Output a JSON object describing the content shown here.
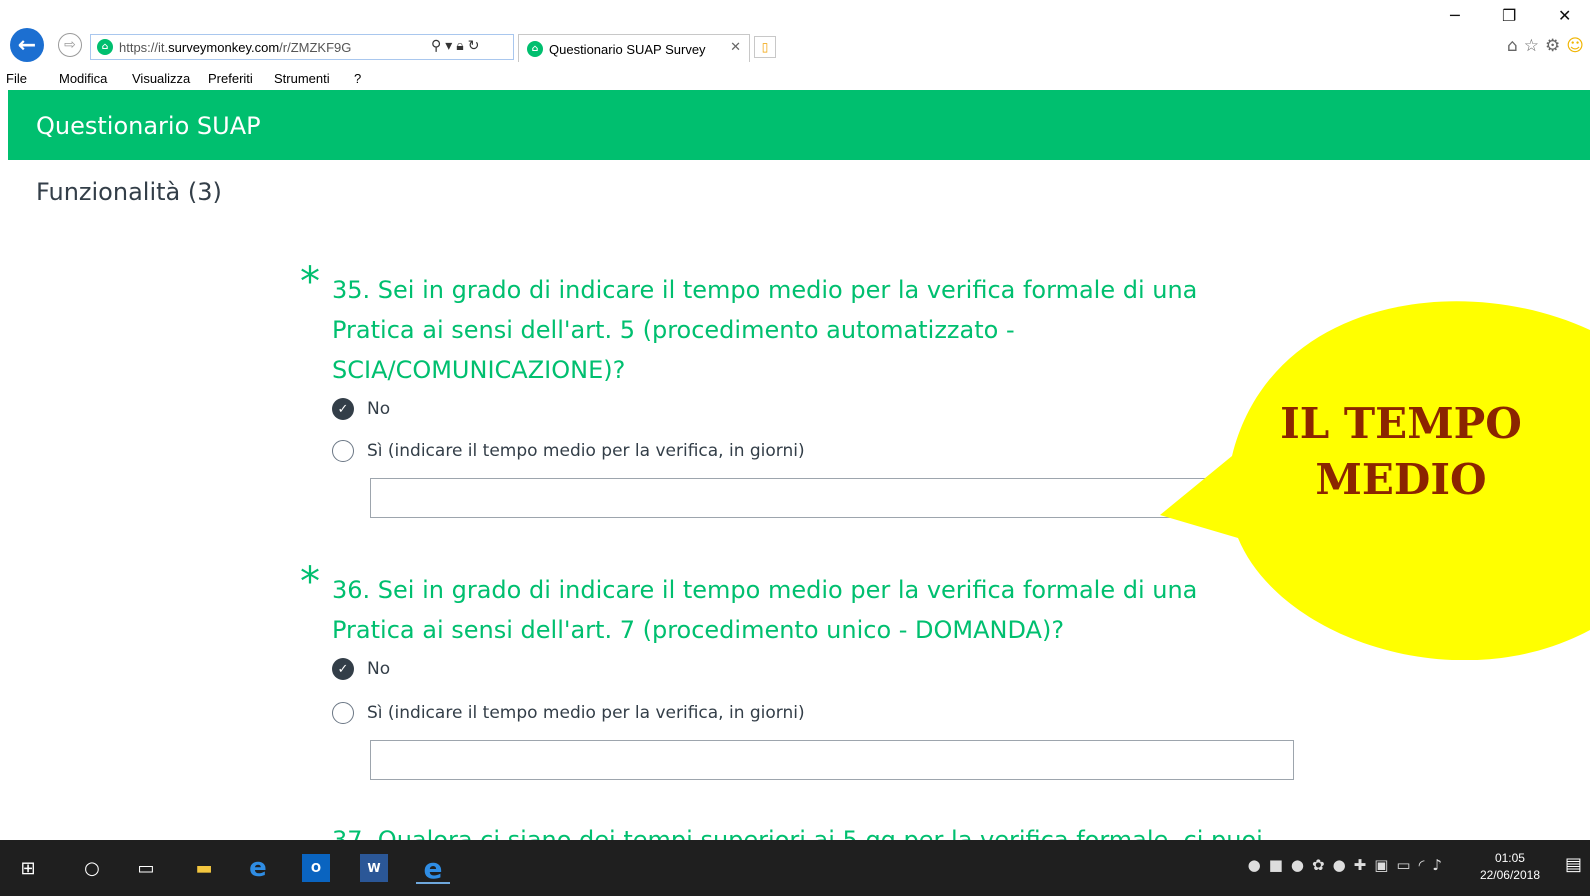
{
  "browser": {
    "url_prefix": "https://it.",
    "url_domain": "surveymonkey.com",
    "url_path": "/r/ZMZKF9G",
    "tab_title": "Questionario SUAP Survey",
    "menu": [
      "File",
      "Modifica",
      "Visualizza",
      "Preferiti",
      "Strumenti",
      "?"
    ]
  },
  "survey": {
    "title": "Questionario SUAP",
    "page_heading": "Funzionalità (3)",
    "questions": [
      {
        "text": "35. Sei in grado di indicare il tempo medio per la verifica formale di una Pratica ai sensi dell'art. 5 (procedimento automatizzato - SCIA/COMUNICAZIONE)?",
        "options": [
          {
            "label": "No",
            "selected": true
          },
          {
            "label": "Sì (indicare il tempo medio per la verifica, in giorni)",
            "selected": false
          }
        ],
        "field_value": ""
      },
      {
        "text": "36. Sei in grado di indicare il tempo medio per la verifica formale di una Pratica ai sensi dell'art. 7 (procedimento unico - DOMANDA)?",
        "options": [
          {
            "label": "No",
            "selected": true
          },
          {
            "label": "Sì (indicare il tempo medio per la verifica, in giorni)",
            "selected": false
          }
        ],
        "field_value": ""
      }
    ],
    "next_question_partial": "37. Qualora ci siano dei tempi superiori ai 5 gg per la verifica formale, ci puoi"
  },
  "callout": {
    "line1": "IL TEMPO",
    "line2": "MEDIO",
    "fill": "#ffff00",
    "text_color": "#8b2500"
  },
  "taskbar": {
    "time": "01:05",
    "date": "22/06/2018"
  },
  "colors": {
    "brand_green": "#00bf6f",
    "text_dark": "#333e48"
  }
}
